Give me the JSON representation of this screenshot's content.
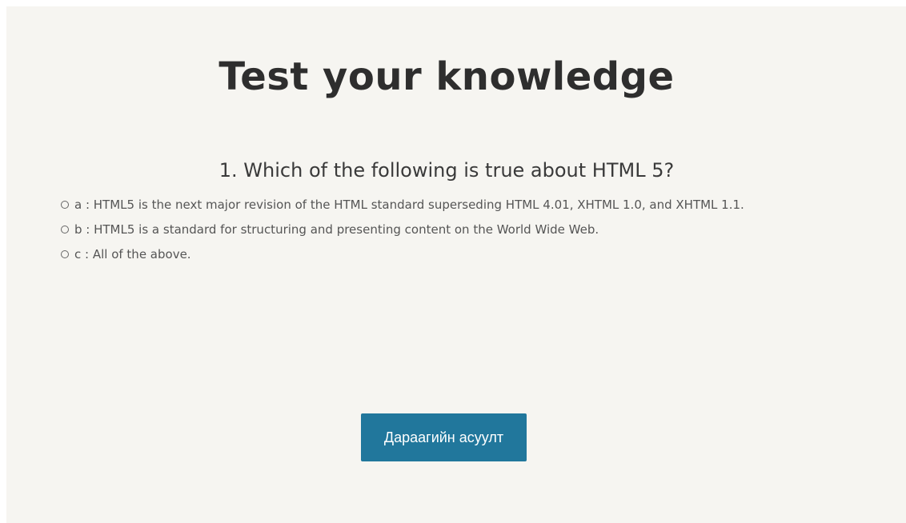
{
  "quiz": {
    "title": "Test your knowledge",
    "question": "1. Which of the following is true about HTML 5?",
    "answers": [
      {
        "letter": "a",
        "text": "a : HTML5 is the next major revision of the HTML standard superseding HTML 4.01, XHTML 1.0, and XHTML 1.1."
      },
      {
        "letter": "b",
        "text": "b : HTML5 is a standard for structuring and presenting content on the World Wide Web."
      },
      {
        "letter": "c",
        "text": "c : All of the above."
      }
    ],
    "next_button_label": "Дараагийн асуулт"
  },
  "colors": {
    "background": "#f6f5f1",
    "button": "#21779c",
    "title_text": "#2e2e2e"
  }
}
